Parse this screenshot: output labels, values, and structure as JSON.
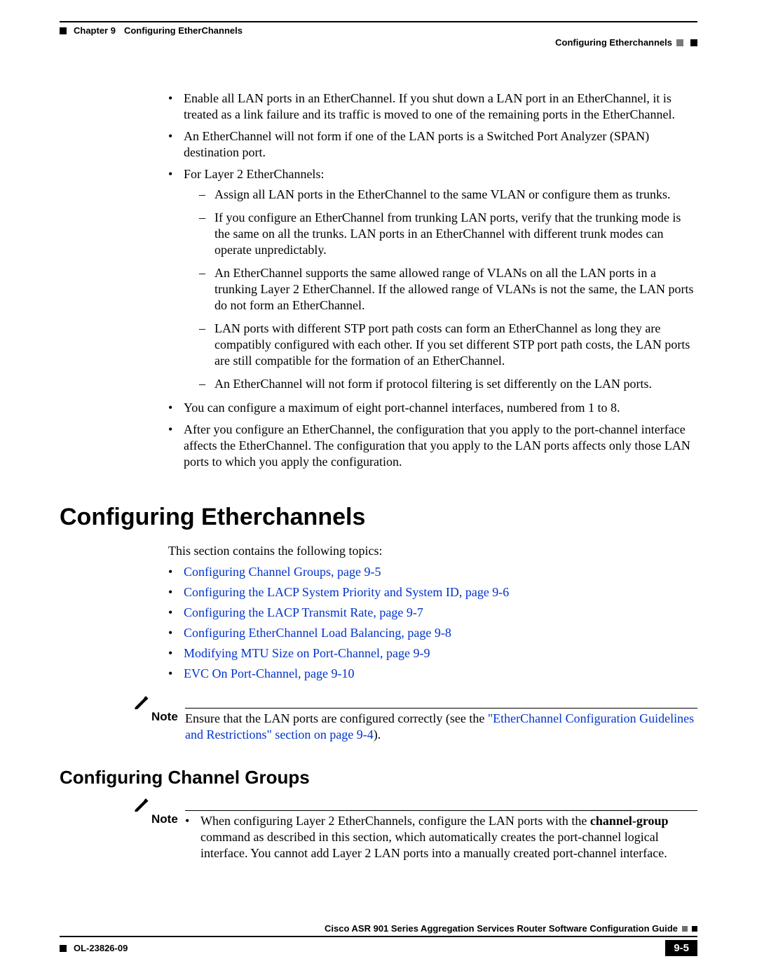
{
  "header": {
    "chapter_label": "Chapter 9",
    "chapter_title": "Configuring EtherChannels",
    "breadcrumb": "Configuring Etherchannels"
  },
  "bullets_top": [
    "Enable all LAN ports in an EtherChannel. If you shut down a LAN port in an EtherChannel, it is treated as a link failure and its traffic is moved to one of the remaining ports in the EtherChannel.",
    "An EtherChannel will not form if one of the LAN ports is a Switched Port Analyzer (SPAN) destination port.",
    "For Layer 2 EtherChannels:"
  ],
  "sub_bullets": [
    "Assign all LAN ports in the EtherChannel to the same VLAN or configure them as trunks.",
    "If you configure an EtherChannel from trunking LAN ports, verify that the trunking mode is the same on all the trunks. LAN ports in an EtherChannel with different trunk modes can operate unpredictably.",
    "An EtherChannel supports the same allowed range of VLANs on all the LAN ports in a trunking Layer 2 EtherChannel. If the allowed range of VLANs is not the same, the LAN ports do not form an EtherChannel.",
    "LAN ports with different STP port path costs can form an EtherChannel as long they are compatibly configured with each other. If you set different STP port path costs, the LAN ports are still compatible for the formation of an EtherChannel.",
    "An EtherChannel will not form if protocol filtering is set differently on the LAN ports."
  ],
  "bullets_after": [
    "You can configure a maximum of eight port-channel interfaces, numbered from 1 to 8.",
    "After you configure an EtherChannel, the configuration that you apply to the port-channel interface affects the EtherChannel. The configuration that you apply to the LAN ports affects only those LAN ports to which you apply the configuration."
  ],
  "section_heading": "Configuring Etherchannels",
  "intro_text": "This section contains the following topics:",
  "links": [
    "Configuring Channel Groups, page 9-5",
    "Configuring the LACP System Priority and System ID, page 9-6",
    "Configuring the LACP Transmit Rate, page 9-7",
    "Configuring EtherChannel Load Balancing, page 9-8",
    "Modifying MTU Size on Port-Channel, page 9-9",
    "EVC On Port-Channel, page 9-10"
  ],
  "note1": {
    "label": "Note",
    "prefix": "Ensure that the LAN ports are configured correctly (see the ",
    "link": "\"EtherChannel Configuration Guidelines and Restrictions\" section on page 9-4",
    "suffix": ")."
  },
  "subsection_heading": "Configuring Channel Groups",
  "note2": {
    "label": "Note",
    "bullet_prefix": "When configuring Layer 2 EtherChannels, configure the LAN ports with the ",
    "bold": "channel-group",
    "bullet_suffix": " command as described in this section, which automatically creates the port-channel logical interface. You cannot add Layer 2 LAN ports into a manually created port-channel interface."
  },
  "footer": {
    "doc_title": "Cisco ASR 901 Series Aggregation Services Router Software Configuration Guide",
    "doc_id": "OL-23826-09",
    "page_num": "9-5"
  }
}
